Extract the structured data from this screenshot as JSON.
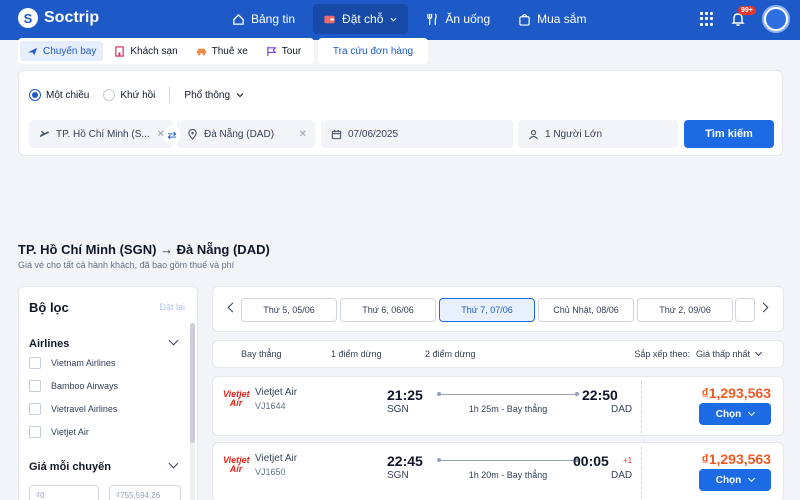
{
  "brand": {
    "name": "Soctrip"
  },
  "nav": [
    {
      "label": "Bảng tin",
      "icon": "home-icon"
    },
    {
      "label": "Đặt chỗ",
      "icon": "wallet-icon",
      "active": true
    },
    {
      "label": "Ăn uống",
      "icon": "utensils-icon"
    },
    {
      "label": "Mua sắm",
      "icon": "bag-icon"
    }
  ],
  "notifications": {
    "badge": "99+"
  },
  "tabs": [
    {
      "label": "Chuyến bay",
      "active": true
    },
    {
      "label": "Khách sạn"
    },
    {
      "label": "Thuê xe"
    },
    {
      "label": "Tour"
    }
  ],
  "lookup_label": "Tra cứu đơn hàng",
  "search": {
    "one_way": "Một chiều",
    "round_trip": "Khứ hồi",
    "cabin": "Phổ thông",
    "from": "TP. Hồ Chí Minh (S...",
    "to": "Đà Nẵng (DAD)",
    "date": "07/06/2025",
    "passengers": "1 Người Lớn",
    "button": "Tìm kiếm"
  },
  "route": {
    "title": "TP. Hồ Chí Minh (SGN) → Đà Nẵng (DAD)",
    "subtitle": "Giá vé cho tất cả hành khách, đã bao gồm thuế và phí"
  },
  "filter": {
    "title": "Bộ lọc",
    "reset": "Đặt lại",
    "airlines_title": "Airlines",
    "airlines": [
      "Vietnam Airlines",
      "Bamboo Airways",
      "Vietravel Airlines",
      "Vietjet Air"
    ],
    "price_title": "Giá mỗi chuyến",
    "price_min": "₫0",
    "price_max": "₫755,594,26"
  },
  "dates": [
    "Thứ 5, 05/06",
    "Thứ 6, 06/06",
    "Thứ 7, 07/06",
    "Chủ Nhật, 08/06",
    "Thứ 2, 09/06"
  ],
  "stops": {
    "direct": "Bay thẳng",
    "one_stop": "1 điểm dừng",
    "two_stops": "2 điểm dừng",
    "sort_label": "Sắp xếp theo:",
    "sort_value": "Giá thấp nhất"
  },
  "flights": [
    {
      "logo": "Vietjet Air",
      "airline": "Vietjet Air",
      "code": "VJ1644",
      "dep_time": "21:25",
      "dep_code": "SGN",
      "arr_time": "22:50",
      "arr_code": "DAD",
      "plus_day": "",
      "duration": "1h 25m - Bay thẳng",
      "price": "₫1,293,563",
      "button": "Chọn"
    },
    {
      "logo": "Vietjet Air",
      "airline": "Vietjet Air",
      "code": "VJ1650",
      "dep_time": "22:45",
      "dep_code": "SGN",
      "arr_time": "00:05",
      "arr_code": "DAD",
      "plus_day": "+1",
      "duration": "1h 20m - Bay thẳng",
      "price": "₫1,293,563",
      "button": "Chọn"
    }
  ]
}
